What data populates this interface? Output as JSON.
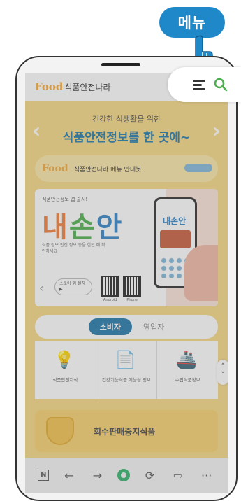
{
  "callout": {
    "label": "메뉴"
  },
  "header": {
    "logo": "Food",
    "logo_suffix": "식품안전나라"
  },
  "banner": {
    "subtitle": "건강한 식생활을 위한",
    "title": "식품안전정보를 한 곳에~",
    "prev": "‹",
    "next": "›"
  },
  "guide": {
    "logo": "Food",
    "text": "식품안전나라 메뉴 안내봇"
  },
  "promo": {
    "small": "식품안전정보 앱 출시!",
    "title_1": "내",
    "title_2": "손",
    "title_3": "안",
    "desc": "식품 정보 안전 정보 등을 한번 에 확인하세요",
    "pill": "스토어 앱 설치 ▶",
    "qr1_label": "Android",
    "qr2_label": "iPhone",
    "mock_title": "내손안"
  },
  "tabs": {
    "active": "소비자",
    "other": "영업자"
  },
  "cards": [
    {
      "icon": "lightbulb-icon",
      "glyph": "💡",
      "label": "식품안전지식"
    },
    {
      "icon": "document-icon",
      "glyph": "📄",
      "label": "건강기능식품 기능성 정보"
    },
    {
      "icon": "ship-icon",
      "glyph": "🚢",
      "label": "수입식품정보"
    }
  ],
  "scroller": {
    "up": "˄",
    "down": "˅"
  },
  "recall": {
    "label": "회수판매중지식품"
  },
  "bottombar": {
    "n": "N",
    "back": "←",
    "forward": "→",
    "reload": "⟳",
    "share": "⇨",
    "more": "···"
  }
}
